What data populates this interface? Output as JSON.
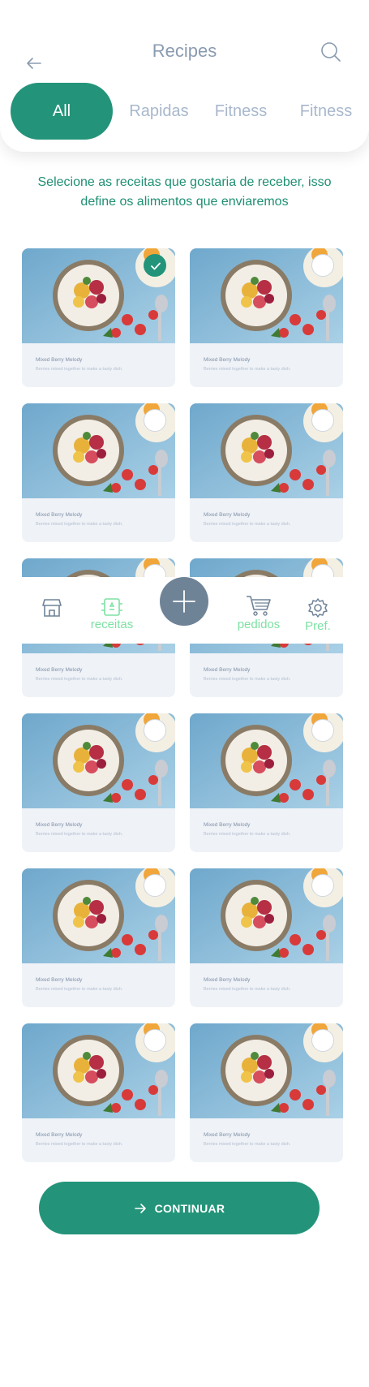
{
  "header": {
    "title": "Recipes",
    "back_icon": "arrow-left-icon",
    "search_icon": "search-icon"
  },
  "tabs": [
    {
      "label": "All",
      "active": true
    },
    {
      "label": "Rapidas",
      "active": false
    },
    {
      "label": "Fitness",
      "active": false
    },
    {
      "label": "Fitness",
      "active": false
    }
  ],
  "subtitle": "Selecione as receitas que gostaria de receber, isso define os alimentos que enviaremos",
  "recipes": [
    {
      "title": "Mixed Berry Melody",
      "desc": "Berries mixed together to make a tasty dish.",
      "selected": true
    },
    {
      "title": "Mixed Berry Melody",
      "desc": "Berries mixed together to make a tasty dish.",
      "selected": false
    },
    {
      "title": "Mixed Berry Melody",
      "desc": "Berries mixed together to make a tasty dish.",
      "selected": false
    },
    {
      "title": "Mixed Berry Melody",
      "desc": "Berries mixed together to make a tasty dish.",
      "selected": false
    },
    {
      "title": "Mixed Berry Melody",
      "desc": "Berries mixed together to make a tasty dish.",
      "selected": false
    },
    {
      "title": "Mixed Berry Melody",
      "desc": "Berries mixed together to make a tasty dish.",
      "selected": false
    },
    {
      "title": "Mixed Berry Melody",
      "desc": "Berries mixed together to make a tasty dish.",
      "selected": false
    },
    {
      "title": "Mixed Berry Melody",
      "desc": "Berries mixed together to make a tasty dish.",
      "selected": false
    },
    {
      "title": "Mixed Berry Melody",
      "desc": "Berries mixed together to make a tasty dish.",
      "selected": false
    },
    {
      "title": "Mixed Berry Melody",
      "desc": "Berries mixed together to make a tasty dish.",
      "selected": false
    },
    {
      "title": "Mixed Berry Melody",
      "desc": "Berries mixed together to make a tasty dish.",
      "selected": false
    },
    {
      "title": "Mixed Berry Melody",
      "desc": "Berries mixed together to make a tasty dish.",
      "selected": false
    }
  ],
  "bottom_nav": {
    "store_icon": "store-icon",
    "recipes_label": "receitas",
    "recipes_icon": "recipe-book-icon",
    "add_icon": "plus-icon",
    "orders_label": "pedidos",
    "orders_icon": "cart-icon",
    "prefs_label": "Pref.",
    "prefs_icon": "gear-icon"
  },
  "continue_button": {
    "label": "CONTINUAR",
    "icon": "arrow-right-icon"
  },
  "colors": {
    "primary": "#239479",
    "accent_nav": "#7de1a3",
    "muted_text": "#a8b8cc",
    "card_bg": "#eff2f7",
    "fab": "#6f8397"
  }
}
